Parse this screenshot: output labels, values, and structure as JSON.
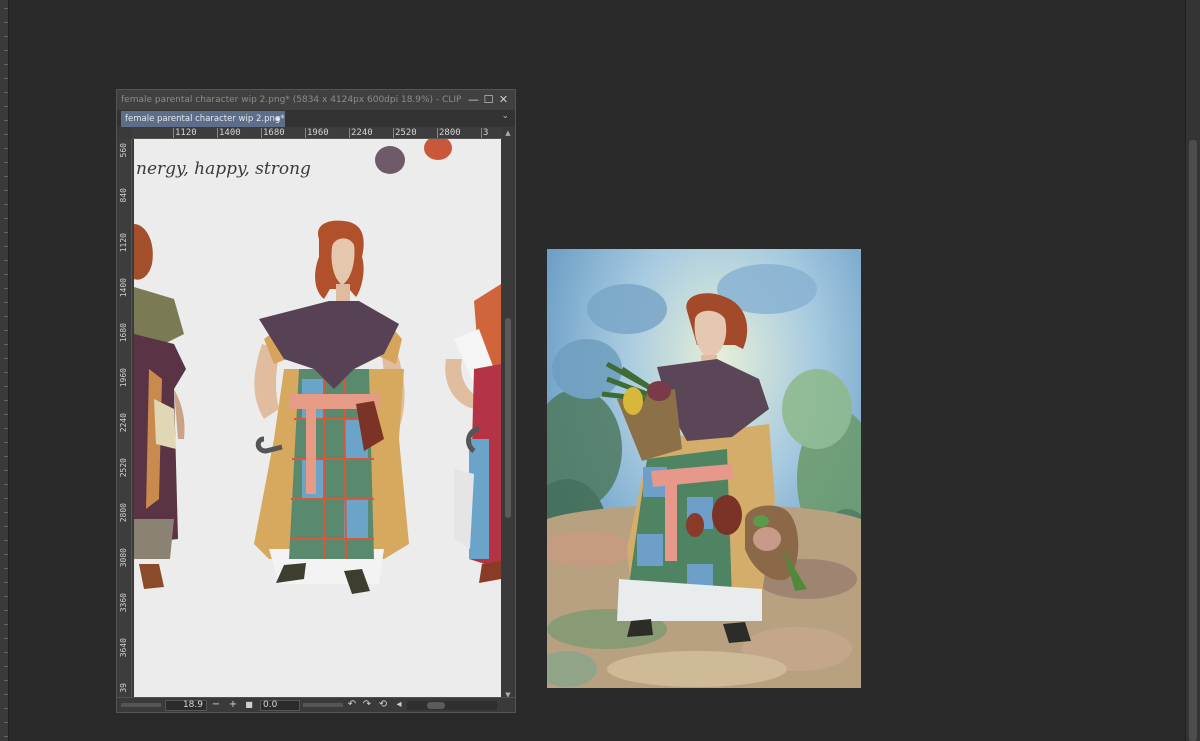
{
  "app": {
    "window_title": "female parental character wip 2.png* (5834 x 4124px 600dpi 18.9%)  - CLIP ST...",
    "tab_label": "female parental character wip 2.png*",
    "window_controls": {
      "minimize": "—",
      "maximize": "☐",
      "close": "✕"
    },
    "tab_menu_chevron": "⌄"
  },
  "top_ruler": {
    "labels": [
      "1120",
      "1400",
      "1680",
      "1960",
      "2240",
      "2520",
      "2800",
      "3"
    ]
  },
  "side_ruler": {
    "labels": [
      "560",
      "840",
      "1120",
      "1400",
      "1680",
      "1960",
      "2240",
      "2520",
      "2800",
      "3080",
      "3360",
      "3640",
      "39"
    ]
  },
  "canvas_text": {
    "handwriting": "nergy, happy, strong"
  },
  "status": {
    "zoom_value": "18.9",
    "zoom_out": "−",
    "zoom_in": "+",
    "fit": "■",
    "rotation_value": "0.0",
    "rotate_left": "↶",
    "rotate_right": "↷",
    "reset_rotation": "⟲",
    "flip": "◂"
  },
  "icons": {
    "palette_swatch_1": "#6e5a68",
    "palette_swatch_2": "#c9573a"
  },
  "colors": {
    "background": "#2a2a2a",
    "window": "#3b3b3b",
    "tab_active": "#5d6e8a",
    "canvas": "#ececec"
  }
}
